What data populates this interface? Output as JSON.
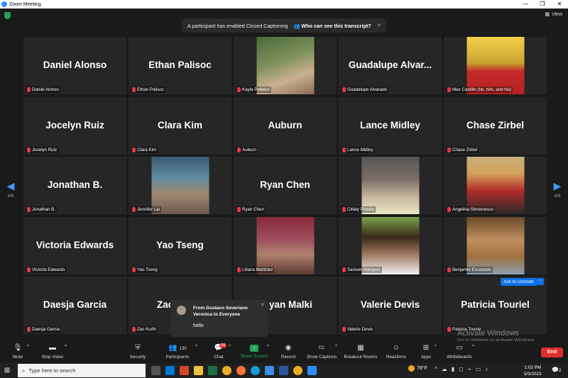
{
  "window": {
    "title": "Zoom Meeting",
    "controls": [
      "—",
      "❐",
      "✕"
    ]
  },
  "top": {
    "view_label": "View",
    "banner_text": "A participant has enabled Closed Captioning",
    "banner_link": "Who can see this transcript?",
    "banner_close": "×"
  },
  "nav": {
    "prev_page": "4/6",
    "next_page": "4/6"
  },
  "participants": [
    {
      "display": "Daniel Alonso",
      "label": "Daniel Alonso"
    },
    {
      "display": "Ethan Palisoc",
      "label": "Ethan Palisoc"
    },
    {
      "display": "",
      "label": "Kayla Peltekci"
    },
    {
      "display": "Guadalupe Alvar...",
      "label": "Guadalupe Alvarado"
    },
    {
      "display": "",
      "label": "Max Castillo (he, him, and his)"
    },
    {
      "display": "Jocelyn Ruiz",
      "label": "Jocelyn Ruiz"
    },
    {
      "display": "Clara Kim",
      "label": "Clara Kim"
    },
    {
      "display": "Auburn",
      "label": "Auburn"
    },
    {
      "display": "Lance Midley",
      "label": "Lance Midley"
    },
    {
      "display": "Chase Zirbel",
      "label": "Chase Zirbel"
    },
    {
      "display": "Jonathan B.",
      "label": "Jonathan B."
    },
    {
      "display": "",
      "label": "Jennifer Lai"
    },
    {
      "display": "Ryan Chen",
      "label": "Ryan Chen"
    },
    {
      "display": "",
      "label": "Citlaly Pineda"
    },
    {
      "display": "",
      "label": "Angelina Simionescu"
    },
    {
      "display": "Victoria Edwards",
      "label": "Victoria Edwards"
    },
    {
      "display": "Yao Tseng",
      "label": "Yao Tseng"
    },
    {
      "display": "",
      "label": "Liliana Martinez"
    },
    {
      "display": "",
      "label": "Samuel Marquez"
    },
    {
      "display": "",
      "label": "Benjamin Escobedo"
    },
    {
      "display": "Daesja Garcia",
      "label": "Daesja Garcia"
    },
    {
      "display": "Zac",
      "label": "Zac Kurth"
    },
    {
      "display": "yan Malki",
      "label": ""
    },
    {
      "display": "Valerie Devis",
      "label": "Valerie Devis"
    },
    {
      "display": "Patricia Touriel",
      "label": "Patricia Touriel"
    }
  ],
  "ask_unmute": "Ask to Unmute",
  "more": "···",
  "chat_popup": {
    "from": "From Gustavo Severiano Veronica to Everyone",
    "message": "hello",
    "close": "×"
  },
  "watermark": {
    "line1": "Activate Windows",
    "line2": "Go to Settings to activate Windows."
  },
  "toolbar": {
    "mute": "Mute",
    "stop_video": "Stop Video",
    "security": "Security",
    "participants": "Participants",
    "participants_count": "130",
    "chat": "Chat",
    "chat_badge": "34",
    "share_screen": "Share Screen",
    "record": "Record",
    "show_captions": "Show Captions",
    "cc": "CC",
    "breakout_rooms": "Breakout Rooms",
    "reactions": "Reactions",
    "apps": "Apps",
    "whiteboards": "Whiteboards",
    "end": "End"
  },
  "taskbar": {
    "search_placeholder": "Type here to search",
    "temperature": "78°F",
    "time": "1:03 PM",
    "date": "5/3/2023",
    "notif_count": "2"
  },
  "colors": {
    "accent_blue": "#0e71eb",
    "end_red": "#e02d2d",
    "share_green": "#23a455",
    "tile_bg": "#262626"
  }
}
